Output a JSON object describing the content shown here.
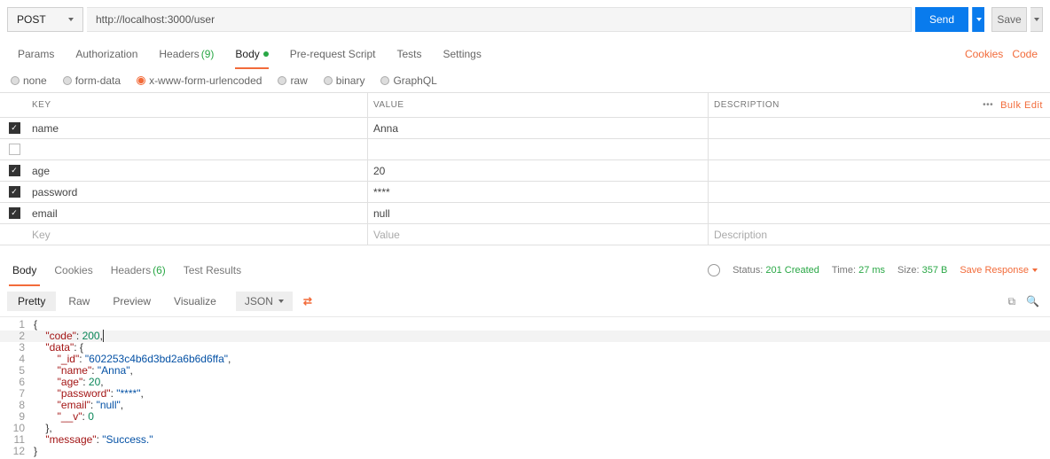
{
  "request": {
    "method": "POST",
    "url": "http://localhost:3000/user",
    "send_label": "Send",
    "save_label": "Save"
  },
  "req_tabs": {
    "params": "Params",
    "authorization": "Authorization",
    "headers": "Headers",
    "headers_count": "(9)",
    "body": "Body",
    "prerequest": "Pre-request Script",
    "tests": "Tests",
    "settings": "Settings",
    "cookies": "Cookies",
    "code": "Code"
  },
  "body_types": {
    "none": "none",
    "formdata": "form-data",
    "urlencoded": "x-www-form-urlencoded",
    "raw": "raw",
    "binary": "binary",
    "graphql": "GraphQL"
  },
  "kv_header": {
    "key": "KEY",
    "value": "VALUE",
    "description": "DESCRIPTION",
    "bulk_edit": "Bulk Edit",
    "dots": "•••"
  },
  "kv_rows": [
    {
      "checked": true,
      "key": "name",
      "value": "Anna",
      "desc": ""
    },
    {
      "checked": false,
      "key": "",
      "value": "",
      "desc": ""
    },
    {
      "checked": true,
      "key": "age",
      "value": "20",
      "desc": ""
    },
    {
      "checked": true,
      "key": "password",
      "value": "****",
      "desc": ""
    },
    {
      "checked": true,
      "key": "email",
      "value": "null",
      "desc": ""
    }
  ],
  "kv_placeholder": {
    "key": "Key",
    "value": "Value",
    "desc": "Description"
  },
  "resp_tabs": {
    "body": "Body",
    "cookies": "Cookies",
    "headers": "Headers",
    "headers_count": "(6)",
    "test_results": "Test Results"
  },
  "resp_meta": {
    "status_label": "Status:",
    "status_value": "201 Created",
    "time_label": "Time:",
    "time_value": "27 ms",
    "size_label": "Size:",
    "size_value": "357 B",
    "save_response": "Save Response"
  },
  "view_bar": {
    "pretty": "Pretty",
    "raw": "Raw",
    "preview": "Preview",
    "visualize": "Visualize",
    "json": "JSON"
  },
  "json_response": {
    "code": 200,
    "data": {
      "_id": "602253c4b6d3bd2a6b6d6ffa",
      "name": "Anna",
      "age": 20,
      "password": "****",
      "email": "null",
      "__v": 0
    },
    "message": "Success."
  }
}
